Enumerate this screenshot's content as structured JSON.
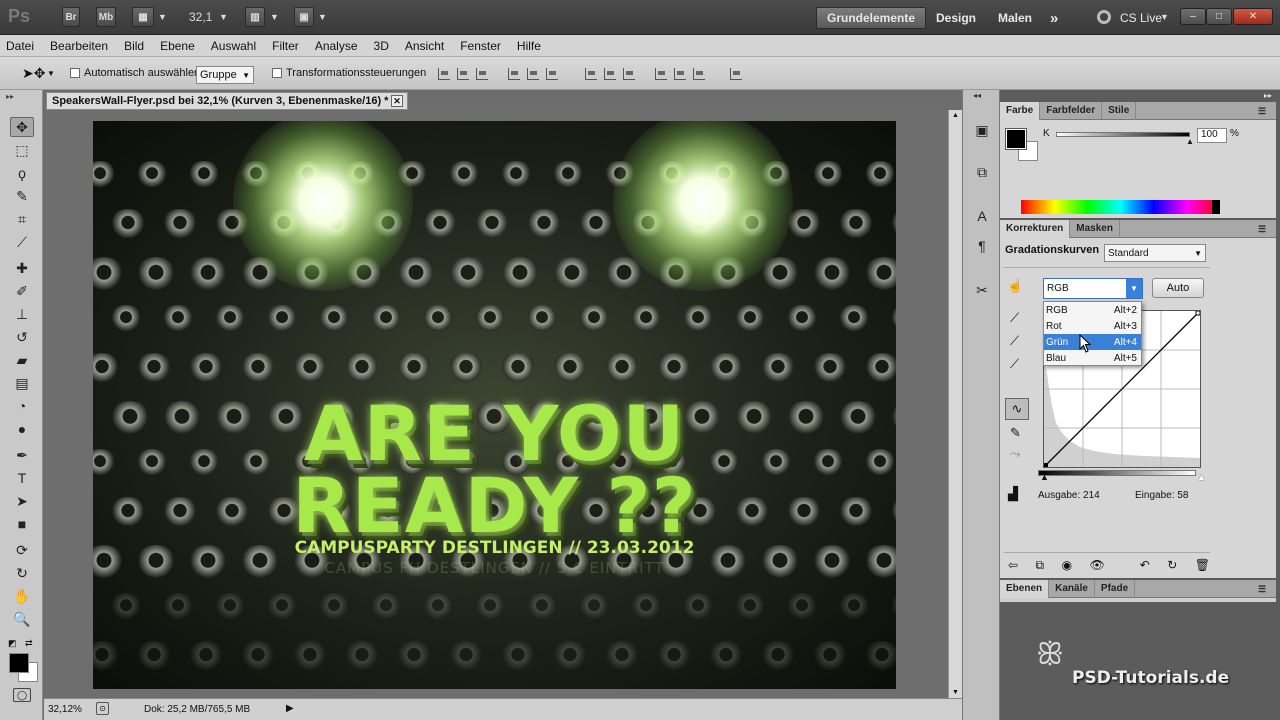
{
  "appbar": {
    "logo": "Ps",
    "btn_bridge": "Br",
    "btn_minibridge": "Mb",
    "zoom": "32,1",
    "workspaces": [
      "Grundelemente",
      "Design",
      "Malen"
    ],
    "more": "»",
    "cslive": "CS Live",
    "win_minimize": "–",
    "win_restore": "□",
    "win_close": "✕"
  },
  "menu": [
    "Datei",
    "Bearbeiten",
    "Bild",
    "Ebene",
    "Auswahl",
    "Filter",
    "Analyse",
    "3D",
    "Ansicht",
    "Fenster",
    "Hilfe"
  ],
  "options": {
    "auto_select_label": "Automatisch auswählen:",
    "auto_select_value": "Gruppe",
    "transform_label": "Transformationssteuerungen"
  },
  "document": {
    "tab_title": "SpeakersWall-Flyer.psd bei 32,1% (Kurven 3, Ebenenmaske/16) *",
    "close": "✕"
  },
  "artwork": {
    "line1": "ARE YOU",
    "line2": "READY ??",
    "subtitle": "CAMPUSPARTY DESTLINGEN // 23.03.2012",
    "subtitle2": "CAMPUS FH DESTLINGEN  //  5 € EINTRITT"
  },
  "status": {
    "zoom": "32,12%",
    "doc": "Dok: 25,2 MB/765,5 MB"
  },
  "color_panel": {
    "tabs": [
      "Farbe",
      "Farbfelder",
      "Stile"
    ],
    "channel": "K",
    "value": "100",
    "unit": "%"
  },
  "adjust_panel": {
    "tabs": [
      "Korrekturen",
      "Masken"
    ],
    "title": "Gradationskurven",
    "preset": "Standard",
    "channel": "RGB",
    "auto": "Auto",
    "output_label": "Ausgabe: 214",
    "input_label": "Eingabe: 58",
    "dropdown": [
      {
        "name": "RGB",
        "shortcut": "Alt+2"
      },
      {
        "name": "Rot",
        "shortcut": "Alt+3"
      },
      {
        "name": "Grün",
        "shortcut": "Alt+4"
      },
      {
        "name": "Blau",
        "shortcut": "Alt+5"
      }
    ],
    "highlighted_index": 2
  },
  "layers_panel": {
    "tabs": [
      "Ebenen",
      "Kanäle",
      "Pfade"
    ]
  },
  "watermark": "PSD-Tutorials.de",
  "colors": {
    "highlight": "#3a80d8",
    "text_green": "#a7e84a"
  }
}
